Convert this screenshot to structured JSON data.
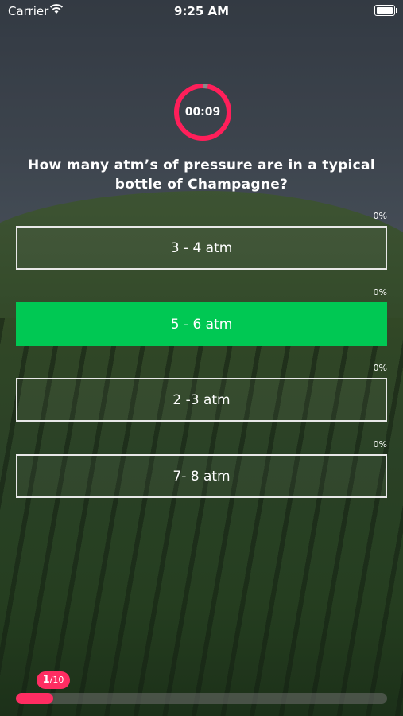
{
  "status_bar": {
    "carrier": "Carrier",
    "time": "9:25 AM"
  },
  "timer": {
    "label": "00:09",
    "progress": 0.03,
    "color": "#ff1f5a"
  },
  "question": "How many atm’s of pressure are in a typical bottle of Champagne?",
  "answers": [
    {
      "label": "3 - 4 atm",
      "percent": "0%",
      "correct": false
    },
    {
      "label": "5 - 6 atm",
      "percent": "0%",
      "correct": true
    },
    {
      "label": "2 -3 atm",
      "percent": "0%",
      "correct": false
    },
    {
      "label": "7- 8 atm",
      "percent": "0%",
      "correct": false
    }
  ],
  "quiz_progress": {
    "current": "1",
    "total": "/10",
    "fraction": 0.1
  },
  "colors": {
    "accent": "#ff2d62",
    "correct": "#00c853"
  }
}
